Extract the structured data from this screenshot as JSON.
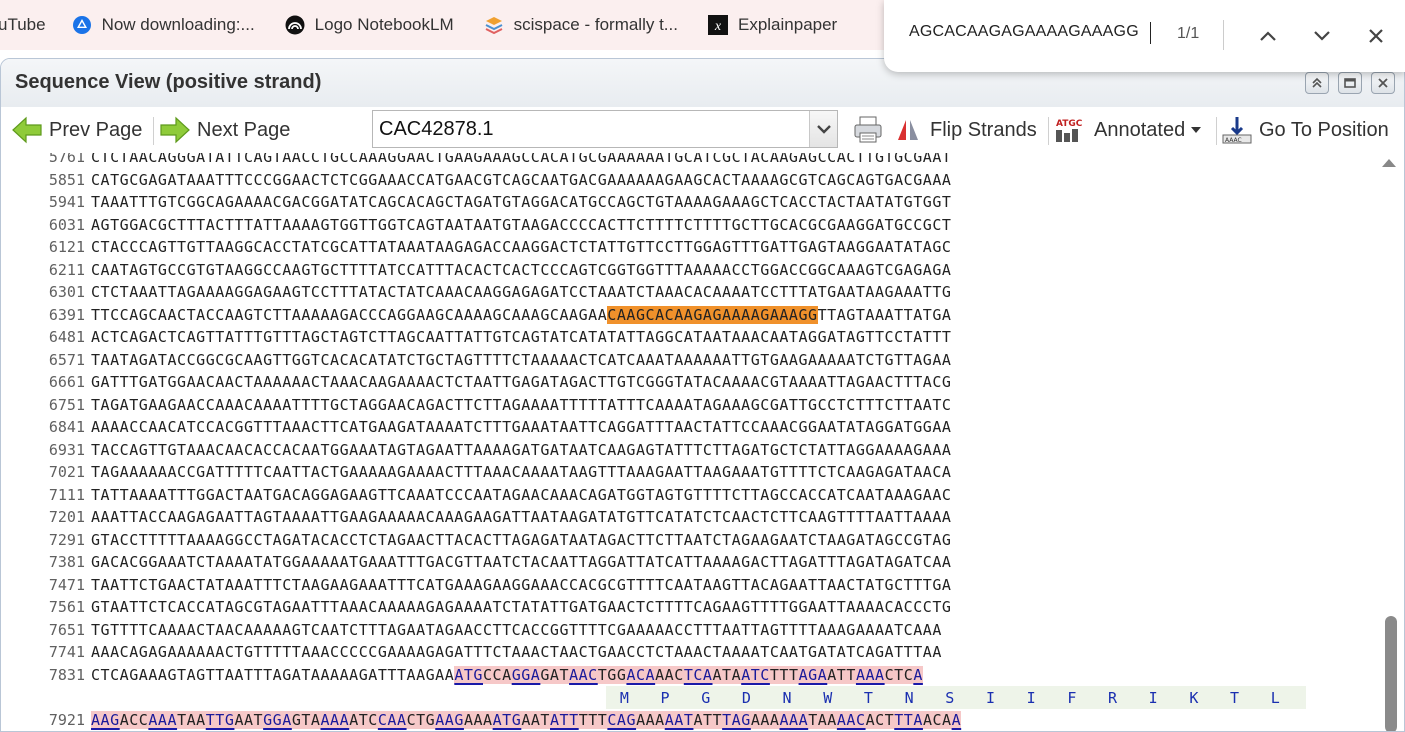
{
  "bookmarks": [
    {
      "label": "uTube",
      "icon": "youtube-icon"
    },
    {
      "label": "Now downloading:...",
      "icon": "drive-icon"
    },
    {
      "label": "Logo NotebookLM",
      "icon": "notebooklm-icon"
    },
    {
      "label": "scispace - formally t...",
      "icon": "scispace-icon"
    },
    {
      "label": "Explainpaper",
      "icon": "explainpaper-icon"
    }
  ],
  "find": {
    "query": "AGCACAAGAGAAAAGAAAGG",
    "count": "1/1"
  },
  "window": {
    "title": "Sequence View (positive strand)"
  },
  "toolbar": {
    "prev_label": "Prev Page",
    "next_label": "Next Page",
    "accession": "CAC42878.1",
    "flip_label": "Flip Strands",
    "annotated_label": "Annotated",
    "goto_label": "Go To Position"
  },
  "sequence": {
    "rows": [
      {
        "pos": "5761",
        "seq": "CTCTAACAGGGATATTCAGTAACCTGCCAAAGGAACTGAAGAAAGCCACATGCGAAAAAATGCATCGCTACAAGAGCCACTTGTGCGAAT"
      },
      {
        "pos": "5851",
        "seq": "CATGCGAGATAAATTTCCCGGAACTCTCGGAAACCATGAACGTCAGCAATGACGAAAAAAGAAGCACTAAAAGCGTCAGCAGTGACGAAA"
      },
      {
        "pos": "5941",
        "seq": "TAAATTTGTCGGCAGAAAACGACGGATATCAGCACAGCTAGATGTAGGACATGCCAGCTGTAAAAGAAAGCTCACCTACTAATATGTGGT"
      },
      {
        "pos": "6031",
        "seq": "AGTGGACGCTTTACTTTATTAAAAGTGGTTGGTCAGTAATAATGTAAGACCCCACTTCTTTTCTTTTGCTTGCACGCGAAGGATGCCGCT"
      },
      {
        "pos": "6121",
        "seq": "CTACCCAGTTGTTAAGGCACCTATCGCATTATAAATAAGAGACCAAGGACTCTATTGTTCCTTGGAGTTTGATTGAGTAAGGAATATAGC"
      },
      {
        "pos": "6211",
        "seq": "CAATAGTGCCGTGTAAGGCCAAGTGCTTTTATCCATTTACACTCACTCCCAGTCGGTGGTTTAAAAACCTGGACCGGCAAAGTCGAGAGA"
      },
      {
        "pos": "6301",
        "seq": "CTCTAAATTAGAAAAGGAGAAGTCCTTTATACTATCAAACAAGGAGAGATCCTAAATCTAAACACAAAATCCTTTATGAATAAGAAATTG"
      },
      {
        "pos": "6391",
        "pre": "TTCCAGCAACTACCAAGTCTTAAAAAGACCCAGGAAGCAAAAGCAAAGCAAGAA",
        "hit": "CAAGCACAAGAGAAAAGAAAGG",
        "post": "TTAGTAAATTATGA"
      },
      {
        "pos": "6481",
        "seq": "ACTCAGACTCAGTTATTTGTTTAGCTAGTCTTAGCAATTATTGTCAGTATCATATATTAGGCATAATAAACAATAGGATAGTTCCTATTT"
      },
      {
        "pos": "6571",
        "seq": "TAATAGATACCGGCGCAAGTTGGTCACACATATCTGCTAGTTTTCTAAAAACTCATCAAATAAAAAATTGTGAAGAAAAATCTGTTAGAA"
      },
      {
        "pos": "6661",
        "seq": "GATTTGATGGAACAACTAAAAAACTAAACAAGAAAACTCTAATTGAGATAGACTTGTCGGGTATACAAAACGTAAAATTAGAACTTTACG"
      },
      {
        "pos": "6751",
        "seq": "TAGATGAAGAACCAAACAAAATTTTGCTAGGAACAGACTTCTTAGAAAATTTTTATTTCAAAATAGAAAGCGATTGCCTCTTTCTTAATC"
      },
      {
        "pos": "6841",
        "seq": "AAAACCAACATCCACGGTTTAAACTTCATGAAGATAAAATCTTTGAAATAATTCAGGATTTAACTATTCCAAACGGAATATAGGATGGAA"
      },
      {
        "pos": "6931",
        "seq": "TACCAGTTGTAAACAACACCACAATGGAAATAGTAGAATTAAAAGATGATAATCAAGAGTATTTCTTAGATGCTCTATTAGGAAAAGAAA"
      },
      {
        "pos": "7021",
        "seq": "TAGAAAAAACCGATTTTTCAATTACTGAAAAAGAAAACTTTAAACAAAATAAGTTTAAAGAATTAAGAAATGTTTTCTCAAGAGATAACA"
      },
      {
        "pos": "7111",
        "seq": "TATTAAAATTTGGACTAATGACAGGAGAAGTTCAAATCCCAATAGAACAAACAGATGGTAGTGTTTTCTTAGCCACCATCAATAAAGAAC"
      },
      {
        "pos": "7201",
        "seq": "AAATTACCAAGAGAATTAGTAAAATTGAAGAAAAACAAAGAAGATTAATAAGATATGTTCATATCTCAACTCTTCAAGTTTTAATTAAAA"
      },
      {
        "pos": "7291",
        "seq": "GTACCTTTTTAAAAGGCCTAGATACACCTCTAGAACTTACACTTAGAGATAATAGACTTCTTAATCTAGAAGAATCTAAGATAGCCGTAG"
      },
      {
        "pos": "7381",
        "seq": "GACACGGAAATCTAAAATATGGAAAAATGAAATTTGACGTTAATCTACAATTAGGATTATCATTAAAAGACTTAGATTTAGATAGATCAA"
      },
      {
        "pos": "7471",
        "seq": "TAATTCTGAACTATAAATTTCTAAGAAGAAATTTCATGAAAGAAGGAAACCACGCGTTTTCAATAAGTTACAGAATTAACTATGCTTTGA"
      },
      {
        "pos": "7561",
        "seq": "GTAATTCTCACCATAGCGTAGAATTTAAACAAAAAGAGAAAATCTATATTGATGAACTCTTTTCAGAAGTTTTGGAATTAAAACACCCTG"
      },
      {
        "pos": "7651",
        "seq": "TGTTTTCAAAACTAACAAAAAGTCAATCTTTAGAATAGAACCTTCACCGGTTTTCGAAAAACCTTTAATTAGTTTTAAAGAAAATCAAA"
      },
      {
        "pos": "7741",
        "seq": "AAACAGAGAAAAAACTGTTTTTAAACCCCCGAAAAGAGATTTCTAAACTAACTGAACCTCTAAACTAAAATCAATGATATCAGATTTAA"
      }
    ],
    "cds_row": {
      "pos": "7831",
      "pre": "CTCAGAAAGTAGTTAATTTAGATAAAAAGATTTAAGAA",
      "codons": [
        "ATG",
        "CCA",
        "GGA",
        "GAT",
        "AAC",
        "TGG",
        "ACA",
        "AAC",
        "TCA",
        "ATA",
        "ATC",
        "TTT",
        "AGA",
        "ATT",
        "AAA",
        "CTC",
        "A"
      ]
    },
    "amino_acids": [
      "M",
      "P",
      "G",
      "D",
      "N",
      "W",
      "T",
      "N",
      "S",
      "I",
      "I",
      "F",
      "R",
      "I",
      "K",
      "T",
      "L"
    ],
    "cds_row2": {
      "pos": "7921",
      "codons": [
        "AAG",
        "ACC",
        "AAA",
        "TAA",
        "TTG",
        "AAT",
        "GGA",
        "GTA",
        "AAA",
        "ATC",
        "CAA",
        "CTG",
        "AAG",
        "AAA",
        "ATG",
        "AAT",
        "ATT",
        "TTT",
        "CAG",
        "AAA",
        "AAT",
        "ATT",
        "TAG",
        "AAA",
        "AAA",
        "TAA",
        "AAC",
        "ACT",
        "TTA",
        "ACA",
        "A"
      ]
    }
  },
  "colors": {
    "hit_highlight": "#f0912b",
    "cds_background": "#f6c8c8",
    "amino_acid_text": "#1a2fb0"
  }
}
